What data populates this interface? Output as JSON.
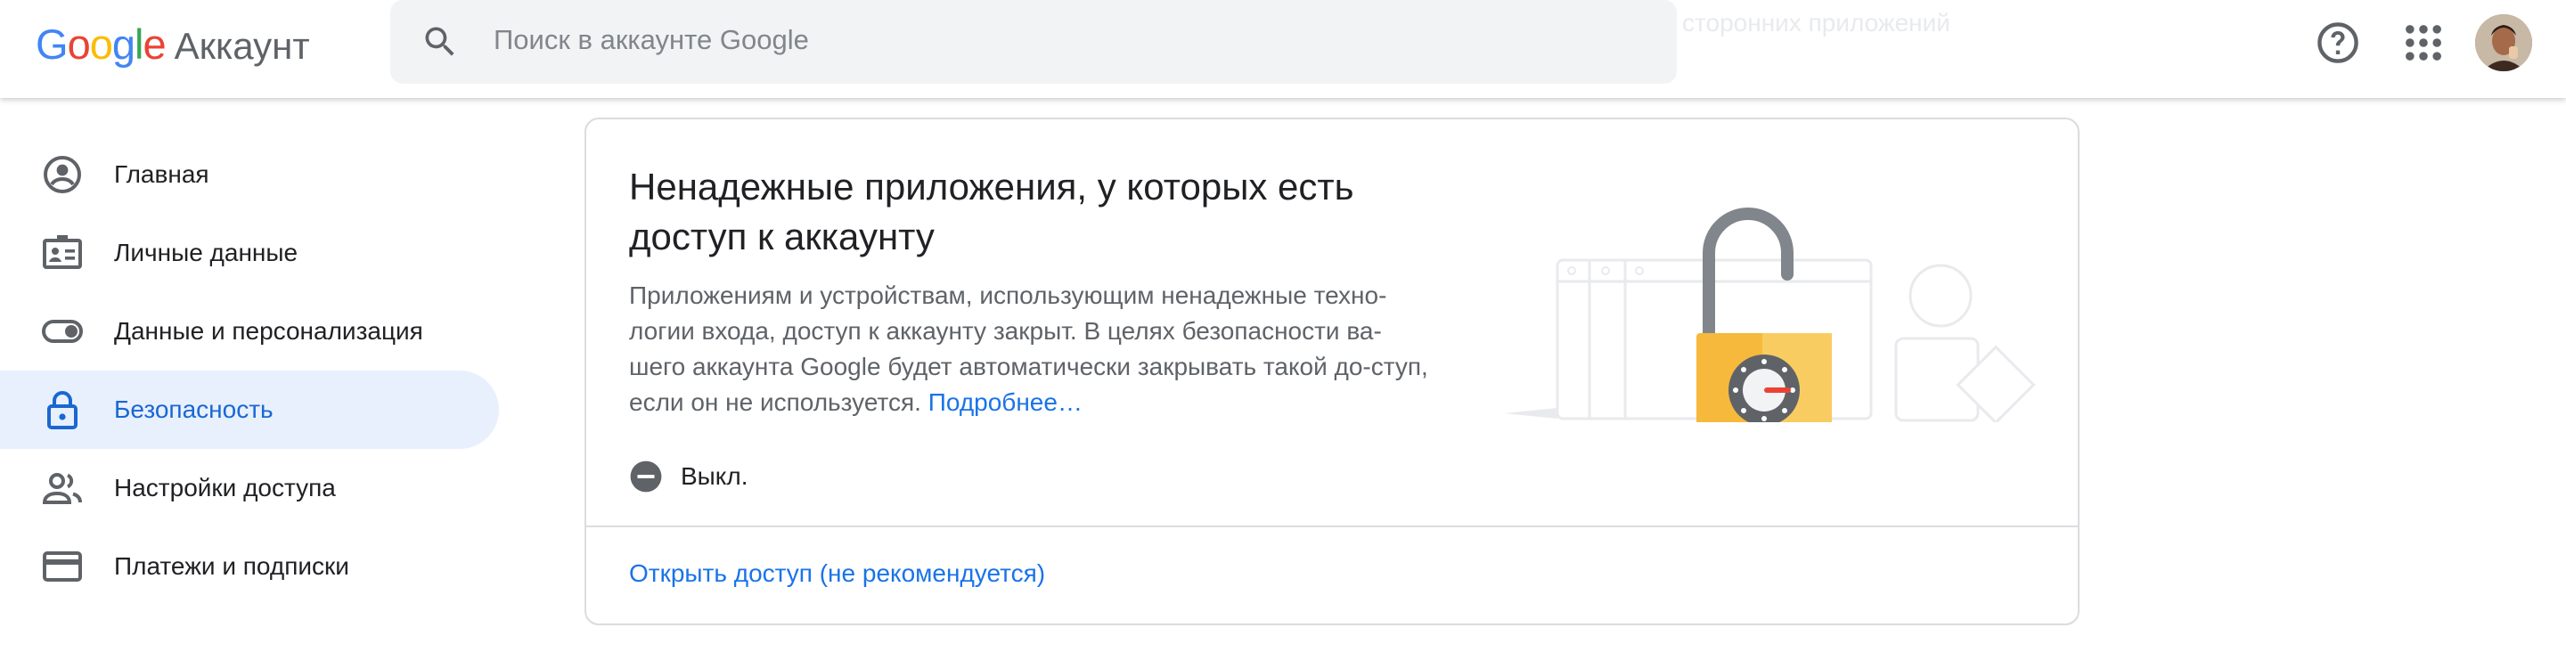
{
  "header": {
    "logo": {
      "google_letters": [
        "G",
        "o",
        "o",
        "g",
        "l",
        "e"
      ],
      "google_colors": [
        "#4285f4",
        "#ea4335",
        "#fbbc05",
        "#4285f4",
        "#34a853",
        "#ea4335"
      ],
      "product": "Аккаунт"
    },
    "search": {
      "placeholder": "Поиск в аккаунте Google"
    },
    "ghost_text": "сторонних приложений",
    "help_icon": "help-circle-icon",
    "apps_icon": "apps-grid-icon"
  },
  "sidebar": {
    "items": [
      {
        "label": "Главная",
        "icon": "account-circle-icon",
        "active": false
      },
      {
        "label": "Личные данные",
        "icon": "badge-icon",
        "active": false
      },
      {
        "label": "Данные и персонализация",
        "icon": "toggle-icon",
        "active": false
      },
      {
        "label": "Безопасность",
        "icon": "lock-icon",
        "active": true
      },
      {
        "label": "Настройки доступа",
        "icon": "people-icon",
        "active": false
      },
      {
        "label": "Платежи и подписки",
        "icon": "credit-card-icon",
        "active": false
      }
    ]
  },
  "card": {
    "title": "Ненадежные приложения, у которых есть доступ к аккаунту",
    "description": "Приложениям и устройствам, использующим ненадежные техно-логии входа, доступ к аккаунту закрыт. В целях безопасности ва-шего аккаунта Google будет автоматически закрывать такой до-ступ, если он не используется.",
    "more_link": "Подробнее…",
    "status_label": "Выкл.",
    "action_link": "Открыть доступ (не рекомендуется)"
  },
  "colors": {
    "accent": "#1a73e8",
    "active_bg": "#e8f0fe",
    "lock_body": "#f6b93b"
  }
}
